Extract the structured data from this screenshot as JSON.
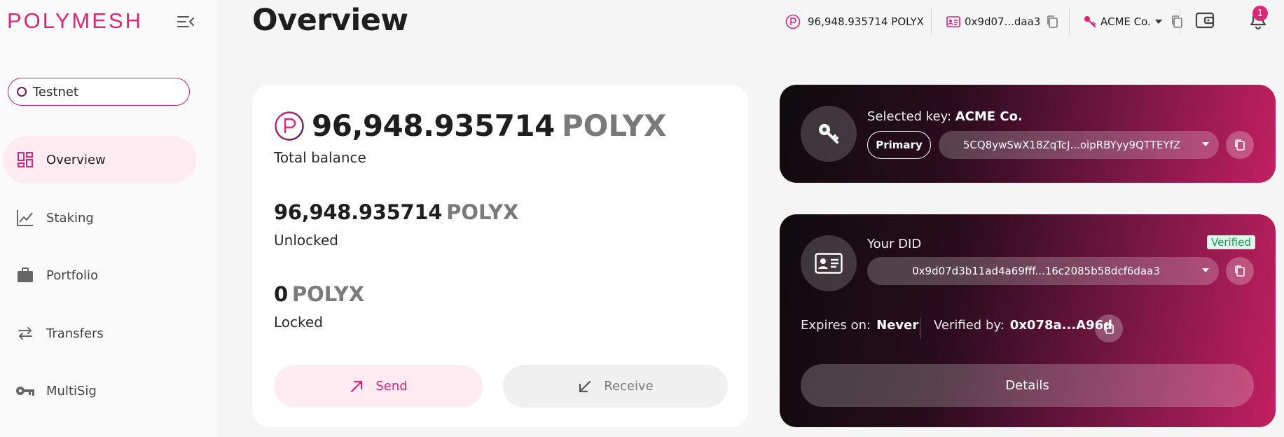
{
  "app": {
    "logo": "POLYMESH"
  },
  "network": {
    "label": "Testnet"
  },
  "sidebar": {
    "items": [
      {
        "label": "Overview",
        "icon": "dashboard-icon",
        "active": true
      },
      {
        "label": "Staking",
        "icon": "chart-line-icon",
        "active": false
      },
      {
        "label": "Portfolio",
        "icon": "briefcase-icon",
        "active": false
      },
      {
        "label": "Transfers",
        "icon": "arrows-swap-icon",
        "active": false
      },
      {
        "label": "MultiSig",
        "icon": "key-icon",
        "active": false
      }
    ]
  },
  "header": {
    "title": "Overview",
    "balance": "96,948.935714 POLYX",
    "did_short": "0x9d07...daa3",
    "account_name": "ACME Co.",
    "notifications_count": "1"
  },
  "balance_card": {
    "total_amount": "96,948.935714",
    "total_unit": "POLYX",
    "total_label": "Total balance",
    "unlocked_amount": "96,948.935714",
    "unlocked_unit": "POLYX",
    "unlocked_label": "Unlocked",
    "locked_amount": "0",
    "locked_unit": "POLYX",
    "locked_label": "Locked",
    "send_label": "Send",
    "receive_label": "Receive"
  },
  "key_card": {
    "selected_prefix": "Selected key:",
    "selected_name": "ACME Co.",
    "primary_label": "Primary",
    "key_address": "5CQ8ywSwX18ZqTcJ...oipRBYyy9QTTEYfZ"
  },
  "did_card": {
    "label": "Your DID",
    "verified_label": "Verified",
    "did": "0x9d07d3b11ad4a69fff...16c2085b58dcf6daa3",
    "expires_label": "Expires on:",
    "expires_value": "Never",
    "verified_by_label": "Verified by:",
    "verified_by_value": "0x078a...A96d",
    "details_label": "Details"
  },
  "colors": {
    "accent": "#e0247a",
    "accent_light": "#ffebf1",
    "verified": "#19a05a"
  }
}
